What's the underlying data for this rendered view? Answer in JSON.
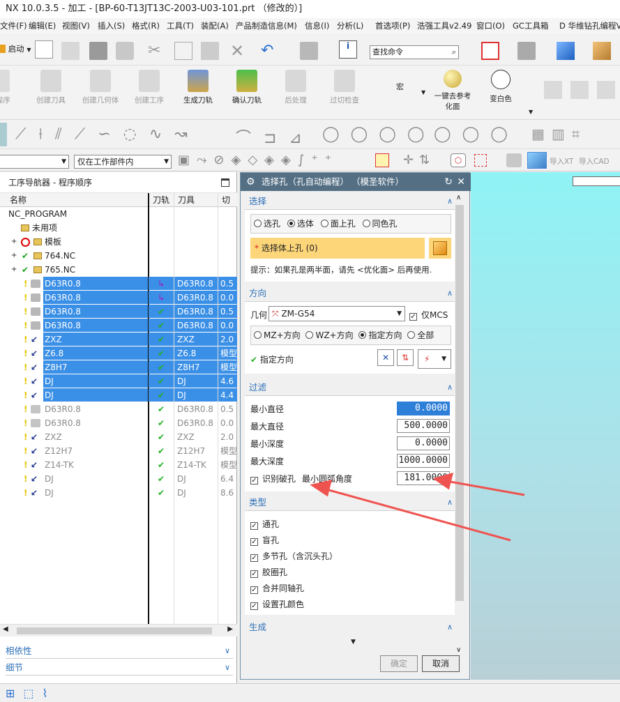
{
  "window": {
    "title": "NX 10.0.3.5 - 加工 - [BP-60-T13JT13C-2003-U03-101.prt （修改的）]"
  },
  "menu": [
    "文件(F)",
    "编辑(E)",
    "视图(V)",
    "插入(S)",
    "格式(R)",
    "工具(T)",
    "装配(A)",
    "产品制造信息(M)",
    "信息(I)",
    "分析(L)",
    "首选项(P)",
    "浩强工具v2.49",
    "窗口(O)",
    "GC工具箱",
    "D 华维钻孔编程V1"
  ],
  "toolbar": {
    "start_label": "启动",
    "search_placeholder": "查找命令"
  },
  "ribbon": {
    "items": [
      "工程序",
      "创建刀具",
      "创建几何体",
      "创建工序",
      "生成刀轨",
      "确认刀轨",
      "后处理",
      "过切检查"
    ],
    "macro_label": "宏",
    "remove_ref_label": "一键去参考化面",
    "change_color_label": "变白色"
  },
  "filter_bar": {
    "scope_value": "仅在工作部件内",
    "import_xt": "导入XT",
    "import_cad": "导入CAD"
  },
  "navigator": {
    "title": "工序导航器 - 程序顺序",
    "columns": [
      "名称",
      "刀轨",
      "刀具",
      "切"
    ],
    "root": "NC_PROGRAM",
    "groups": [
      "未用项",
      "模板",
      "764.NC",
      "765.NC"
    ],
    "rows": [
      {
        "name": "D63R0.8",
        "tool": "D63R0.8",
        "cut": "0.5"
      },
      {
        "name": "D63R0.8",
        "tool": "D63R0.8",
        "cut": "0.0"
      },
      {
        "name": "D63R0.8",
        "tool": "D63R0.8",
        "cut": "0.5"
      },
      {
        "name": "D63R0.8",
        "tool": "D63R0.8",
        "cut": "0.0"
      },
      {
        "name": "ZXZ",
        "tool": "ZXZ",
        "cut": "2.0"
      },
      {
        "name": "Z6.8",
        "tool": "Z6.8",
        "cut": "模型"
      },
      {
        "name": "Z8H7",
        "tool": "Z8H7",
        "cut": "模型"
      },
      {
        "name": "DJ",
        "tool": "DJ",
        "cut": "4.6"
      },
      {
        "name": "DJ",
        "tool": "DJ",
        "cut": "4.4"
      },
      {
        "name": "D63R0.8",
        "tool": "D63R0.8",
        "cut": "0.5"
      },
      {
        "name": "D63R0.8",
        "tool": "D63R0.8",
        "cut": "0.0"
      },
      {
        "name": "ZXZ",
        "tool": "ZXZ",
        "cut": "2.0"
      },
      {
        "name": "Z12H7",
        "tool": "Z12H7",
        "cut": "模型"
      },
      {
        "name": "Z14-TK",
        "tool": "Z14-TK",
        "cut": "模型"
      },
      {
        "name": "DJ",
        "tool": "DJ",
        "cut": "6.4"
      },
      {
        "name": "DJ",
        "tool": "DJ",
        "cut": "8.6"
      }
    ],
    "sections": [
      "相依性",
      "细节"
    ]
  },
  "dialog": {
    "title": "选择孔（孔自动编程）  （模圣软件）",
    "select": {
      "header": "选择",
      "radios": [
        "选孔",
        "选体",
        "面上孔",
        "同色孔"
      ],
      "body_hole_label": "选择体上孔 (0)",
      "hint": "提示：如果孔是两半面，请先 <优化面> 后再使用."
    },
    "direction": {
      "header": "方向",
      "geometry_label": "几何",
      "geometry_value": "ZM-G54",
      "mcs_only": "仅MCS",
      "radios": [
        "MZ+方向",
        "WZ+方向",
        "指定方向",
        "全部"
      ],
      "specify_label": "指定方向"
    },
    "filter": {
      "header": "过滤",
      "min_dia_label": "最小直径",
      "min_dia": "0.0000",
      "max_dia_label": "最大直径",
      "max_dia": "500.0000",
      "min_depth_label": "最小深度",
      "min_depth": "0.0000",
      "max_depth_label": "最大深度",
      "max_depth": "1000.0000",
      "broken_hole_label": "识别破孔",
      "min_arc_label": "最小圆弧角度",
      "min_arc": "181.0000"
    },
    "types": {
      "header": "类型",
      "items": [
        "通孔",
        "盲孔",
        "多节孔（含沉头孔）",
        "胶圈孔",
        "合并同轴孔",
        "设置孔颜色"
      ]
    },
    "generate": {
      "header": "生成"
    },
    "ok_label": "确定",
    "cancel_label": "取消"
  },
  "colors": {
    "selection": "#3a8fe6",
    "dialog_title": "#546f84",
    "section": "#2c6fb6",
    "arrow": "#ef5350"
  }
}
